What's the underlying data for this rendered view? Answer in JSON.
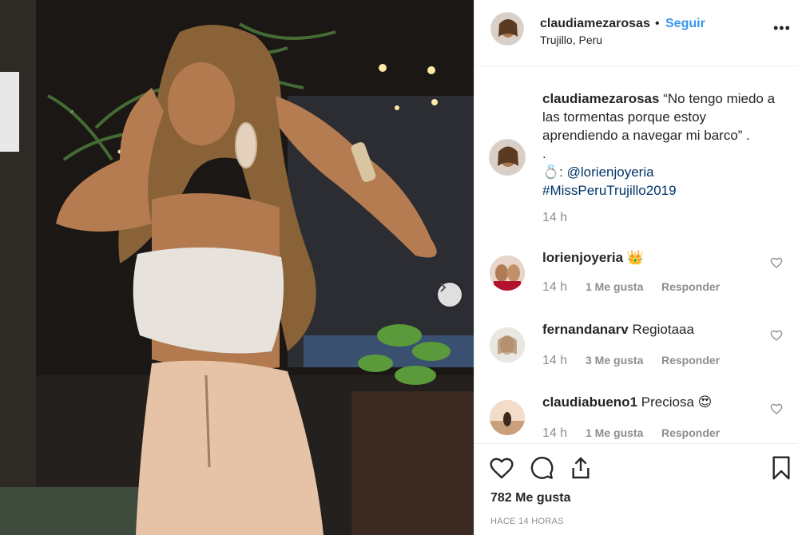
{
  "header": {
    "username": "claudiamezarosas",
    "dot": "•",
    "follow_label": "Seguir",
    "location": "Trujillo, Peru",
    "more_icon": "more-options-icon"
  },
  "caption": {
    "username": "claudiamezarosas",
    "text_line": "“No tengo miedo a las tormentas porque estoy aprendiendo a navegar mi barco” .",
    "dot_line": ".",
    "ring_emoji": "💍",
    "ring_sep": ":",
    "mention": "@lorienjoyeria",
    "hashtag": "#MissPeruTrujillo2019",
    "time": "14 h"
  },
  "comments": [
    {
      "username": "lorienjoyeria",
      "text": "",
      "emoji": "👑",
      "time": "14 h",
      "likes": "1 Me gusta",
      "reply": "Responder"
    },
    {
      "username": "fernandanarv",
      "text": "Regiotaaa",
      "emoji": "",
      "time": "14 h",
      "likes": "3 Me gusta",
      "reply": "Responder"
    },
    {
      "username": "claudiabueno1",
      "text": "Preciosa",
      "emoji": "😍",
      "time": "14 h",
      "likes": "1 Me gusta",
      "reply": "Responder"
    }
  ],
  "footer": {
    "likes_count": "782 Me gusta",
    "posted_ago": "HACE 14 HORAS"
  },
  "colors": {
    "link": "#3897f0",
    "mention": "#003569",
    "muted": "#8e8e8e",
    "text": "#262626",
    "border": "#efefef"
  }
}
